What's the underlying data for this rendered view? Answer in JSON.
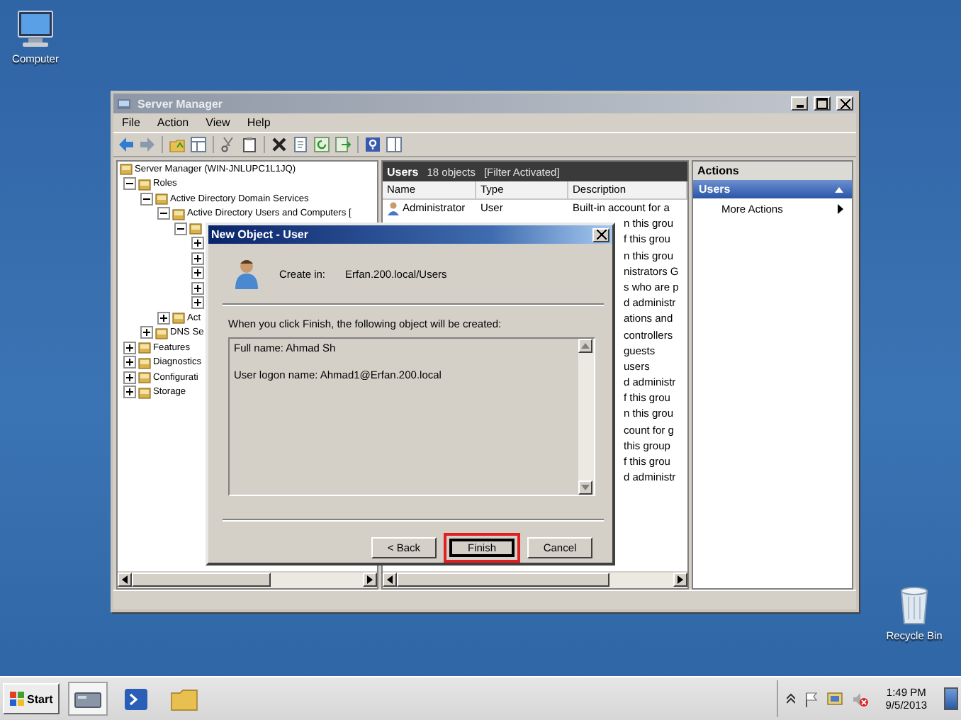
{
  "desktop_icons": [
    {
      "kind": "computer",
      "label": "Computer"
    },
    {
      "kind": "recycle",
      "label": "Recycle Bin"
    }
  ],
  "window": {
    "title": "Server Manager",
    "menu": [
      "File",
      "Action",
      "View",
      "Help"
    ]
  },
  "tree": [
    {
      "label": "Server Manager (WIN-JNLUPC1L1JQ)",
      "children": [
        {
          "label": "Roles",
          "expanded": true,
          "children": [
            {
              "label": "Active Directory Domain Services",
              "expanded": true,
              "children": [
                {
                  "label": "Active Directory Users and Computers [",
                  "expanded": true,
                  "children": [
                    {
                      "expanded": true,
                      "children": [
                        {
                          "expanded": false
                        },
                        {
                          "expanded": false
                        },
                        {
                          "expanded": false
                        },
                        {
                          "expanded": false
                        },
                        {
                          "expanded": false
                        }
                      ]
                    }
                  ]
                },
                {
                  "label": "Act",
                  "expanded": false
                }
              ]
            },
            {
              "label": "DNS Se",
              "expanded": false
            }
          ]
        },
        {
          "label": "Features",
          "expanded": false
        },
        {
          "label": "Diagnostics",
          "expanded": false
        },
        {
          "label": "Configurati",
          "expanded": false
        },
        {
          "label": "Storage",
          "expanded": false
        }
      ]
    }
  ],
  "list": {
    "title": "Users",
    "count": "18 objects",
    "filter": "[Filter Activated]",
    "columns": [
      "Name",
      "Type",
      "Description"
    ],
    "rows": [
      {
        "name": "Administrator",
        "type": "User",
        "description": "Built-in account for a"
      },
      {
        "description": "n this grou"
      },
      {
        "description": "f this grou"
      },
      {
        "description": "n this grou"
      },
      {
        "description": "nistrators G"
      },
      {
        "description": "s who are p"
      },
      {
        "description": "d administr"
      },
      {
        "description": "ations and"
      },
      {
        "description": "controllers"
      },
      {
        "description": "guests"
      },
      {
        "description": "users"
      },
      {
        "description": "d administr"
      },
      {
        "description": "f this grou"
      },
      {
        "description": "n this grou"
      },
      {
        "description": "count for g"
      },
      {
        "description": "this group"
      },
      {
        "description": "f this grou"
      },
      {
        "description": "d administr"
      }
    ]
  },
  "actions": {
    "title": "Actions",
    "section": "Users",
    "expanded": true,
    "items": [
      "More Actions"
    ]
  },
  "dialog": {
    "title": "New Object - User",
    "create_in_label": "Create in:",
    "create_in_value": "Erfan.200.local/Users",
    "prompt": "When you click Finish, the following object will be created:",
    "summary": [
      "Full name: Ahmad Sh",
      "User logon name: Ahmad1@Erfan.200.local"
    ],
    "buttons": [
      {
        "label": "< Back",
        "default": false,
        "highlighted": false
      },
      {
        "label": "Finish",
        "default": true,
        "highlighted": true
      },
      {
        "label": "Cancel",
        "default": false,
        "highlighted": false
      }
    ]
  },
  "taskbar": {
    "start": "Start",
    "time": "1:49 PM",
    "date": "9/5/2013"
  }
}
